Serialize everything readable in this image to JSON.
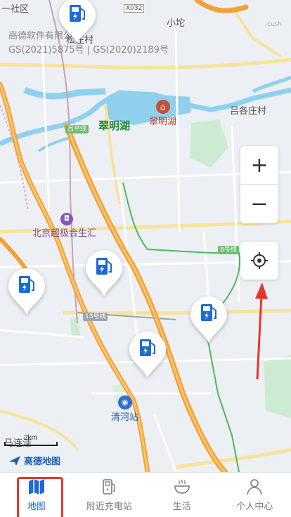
{
  "map": {
    "copyright_line1": "高德软件有限公司",
    "copyright_line2": "GS(2021)5875号 | GS(2020)2189号",
    "places": {
      "songzhuang": "松庄村",
      "xiaotuo": "小坨",
      "lvgezhuang": "吕各庄村",
      "machuanwa": "马连洼"
    },
    "lake": "翠明湖",
    "poi_park": "翠明湖",
    "poi_mall": "北京超极合生汇",
    "station": "清河站",
    "road_tags": {
      "lvping": "吕平线",
      "line8": "8号线",
      "line13": "13号线",
      "x032": "X032"
    },
    "scale_label": "2km",
    "amap_logo": "高德地图",
    "top_left_clip": "一社区",
    "top_right_clip": "cush"
  },
  "controls": {
    "zoom_in": "+",
    "zoom_out": "−"
  },
  "tabs": [
    {
      "label": "地图",
      "icon": "map-icon",
      "active": true
    },
    {
      "label": "附近充电站",
      "icon": "charging-station-icon",
      "active": false
    },
    {
      "label": "生活",
      "icon": "bowl-icon",
      "active": false
    },
    {
      "label": "个人中心",
      "icon": "person-icon",
      "active": false
    }
  ],
  "colors": {
    "accent_blue": "#1b6ad6",
    "highlight_red": "#e0392b",
    "expressway_orange": "#f5a623",
    "water": "#8fd0ee"
  }
}
